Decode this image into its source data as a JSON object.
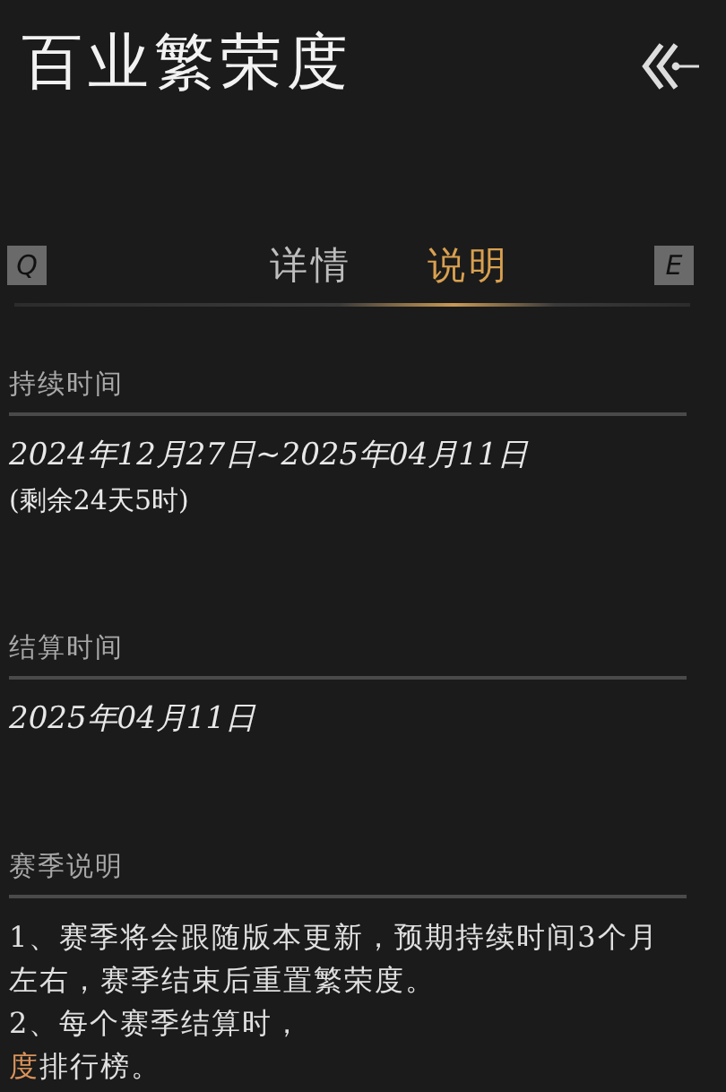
{
  "title": "百业繁荣度",
  "tabs_bar": {
    "prev_key": "Q",
    "next_key": "E",
    "tabs": [
      {
        "label": "详情",
        "selected": false
      },
      {
        "label": "说明",
        "selected": true
      }
    ]
  },
  "sections": [
    {
      "heading": "持续时间",
      "lines": [
        "2024年12月27日~2025年04月11日",
        "(剩余24天5时)"
      ]
    },
    {
      "heading": "结算时间",
      "lines": [
        "2025年04月11日"
      ]
    },
    {
      "heading": "赛季说明",
      "paragraphs": [
        [
          {
            "text": "1、赛季将会跟随版本更新，预期持续时间3个月左右，赛季结束后重置繁荣度。",
            "highlight": false
          }
        ],
        [
          {
            "text": "2、每个赛季结算时，",
            "highlight": false
          }
        ],
        [
          {
            "text": "度",
            "highlight": true
          },
          {
            "text": "排行榜。",
            "highlight": false
          }
        ]
      ]
    }
  ]
}
